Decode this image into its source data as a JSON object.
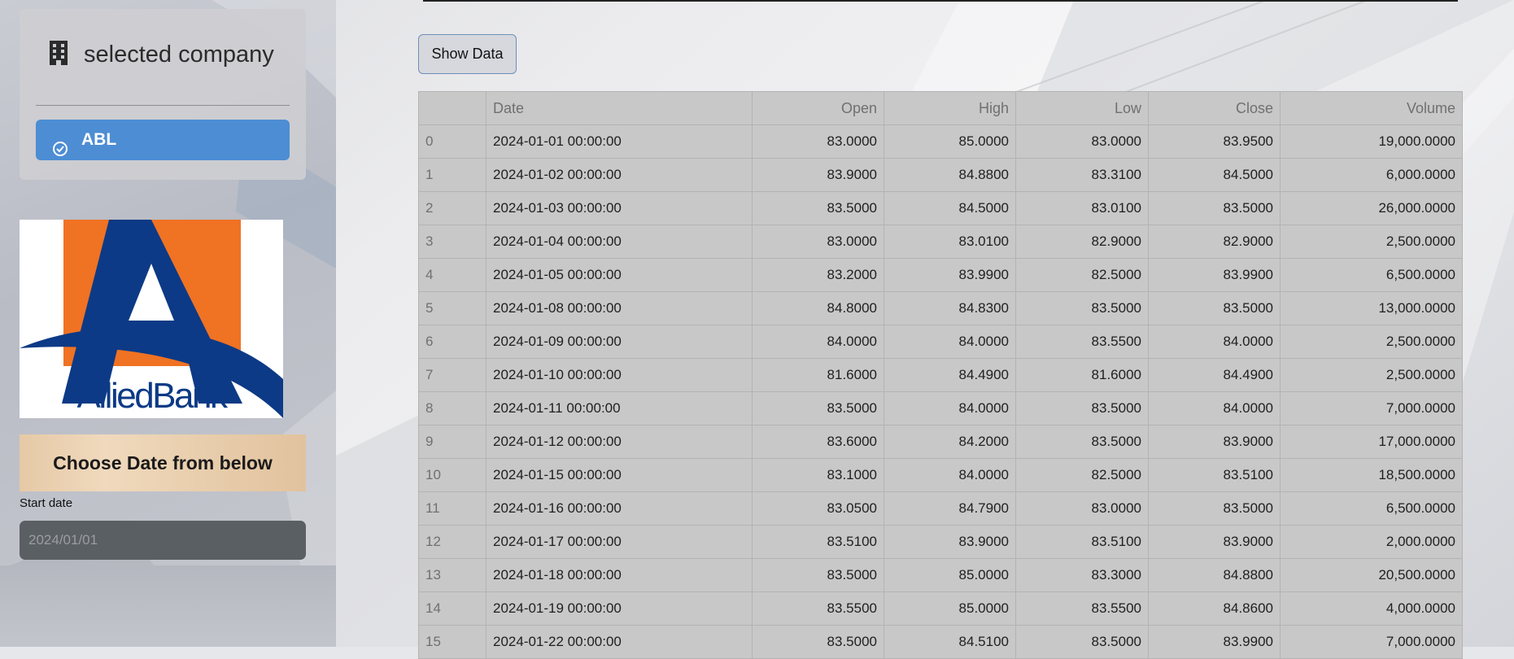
{
  "sidebar": {
    "company_title": "selected company",
    "company_icon": "building-icon",
    "company_button_label": "ABL",
    "logo_text": "AlliedBank",
    "date_banner": "Choose Date from below",
    "start_date_label": "Start date",
    "start_date_value": "2024/01/01"
  },
  "main": {
    "show_data_label": "Show Data"
  },
  "colors": {
    "accent": "#4d8dd3",
    "logo_orange": "#f07223",
    "logo_navy": "#0c3a86"
  },
  "table": {
    "columns": [
      "",
      "Date",
      "Open",
      "High",
      "Low",
      "Close",
      "Volume"
    ],
    "rows": [
      [
        "0",
        "2024-01-01 00:00:00",
        "83.0000",
        "85.0000",
        "83.0000",
        "83.9500",
        "19,000.0000"
      ],
      [
        "1",
        "2024-01-02 00:00:00",
        "83.9000",
        "84.8800",
        "83.3100",
        "84.5000",
        "6,000.0000"
      ],
      [
        "2",
        "2024-01-03 00:00:00",
        "83.5000",
        "84.5000",
        "83.0100",
        "83.5000",
        "26,000.0000"
      ],
      [
        "3",
        "2024-01-04 00:00:00",
        "83.0000",
        "83.0100",
        "82.9000",
        "82.9000",
        "2,500.0000"
      ],
      [
        "4",
        "2024-01-05 00:00:00",
        "83.2000",
        "83.9900",
        "82.5000",
        "83.9900",
        "6,500.0000"
      ],
      [
        "5",
        "2024-01-08 00:00:00",
        "84.8000",
        "84.8300",
        "83.5000",
        "83.5000",
        "13,000.0000"
      ],
      [
        "6",
        "2024-01-09 00:00:00",
        "84.0000",
        "84.0000",
        "83.5500",
        "84.0000",
        "2,500.0000"
      ],
      [
        "7",
        "2024-01-10 00:00:00",
        "81.6000",
        "84.4900",
        "81.6000",
        "84.4900",
        "2,500.0000"
      ],
      [
        "8",
        "2024-01-11 00:00:00",
        "83.5000",
        "84.0000",
        "83.5000",
        "84.0000",
        "7,000.0000"
      ],
      [
        "9",
        "2024-01-12 00:00:00",
        "83.6000",
        "84.2000",
        "83.5000",
        "83.9000",
        "17,000.0000"
      ],
      [
        "10",
        "2024-01-15 00:00:00",
        "83.1000",
        "84.0000",
        "82.5000",
        "83.5100",
        "18,500.0000"
      ],
      [
        "11",
        "2024-01-16 00:00:00",
        "83.0500",
        "84.7900",
        "83.0000",
        "83.5000",
        "6,500.0000"
      ],
      [
        "12",
        "2024-01-17 00:00:00",
        "83.5100",
        "83.9000",
        "83.5100",
        "83.9000",
        "2,000.0000"
      ],
      [
        "13",
        "2024-01-18 00:00:00",
        "83.5000",
        "85.0000",
        "83.3000",
        "84.8800",
        "20,500.0000"
      ],
      [
        "14",
        "2024-01-19 00:00:00",
        "83.5500",
        "85.0000",
        "83.5500",
        "84.8600",
        "4,000.0000"
      ],
      [
        "15",
        "2024-01-22 00:00:00",
        "83.5000",
        "84.5100",
        "83.5000",
        "83.9900",
        "7,000.0000"
      ]
    ]
  }
}
